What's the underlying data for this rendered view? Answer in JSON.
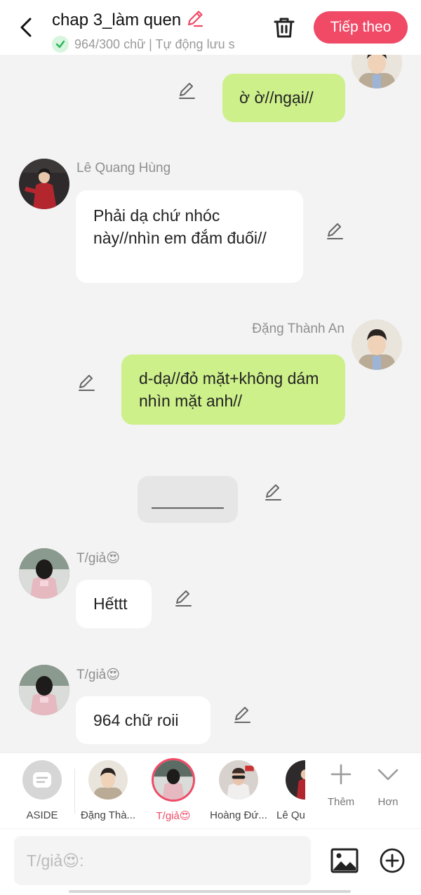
{
  "header": {
    "title": "chap 3_làm quen",
    "subtitle": "964/300 chữ | Tự động lưu s",
    "next_label": "Tiếp theo"
  },
  "messages": [
    {
      "speaker": "",
      "text": "ờ ờ//ngại//",
      "side": "right",
      "style": "green"
    },
    {
      "speaker": "Lê Quang Hùng",
      "text": "Phải dạ chứ nhóc này//nhìn em đắm đuối//",
      "side": "left",
      "style": "white"
    },
    {
      "speaker": "Đặng Thành An",
      "text": "d-dạ//đỏ mặt+không dám nhìn mặt anh//",
      "side": "right",
      "style": "green"
    },
    {
      "speaker": "",
      "text": "________",
      "side": "center",
      "style": "aside"
    },
    {
      "speaker": "T/giả😍",
      "text": "Hếttt",
      "side": "left",
      "style": "white"
    },
    {
      "speaker": "T/giả😍",
      "text": "964 chữ roii",
      "side": "left",
      "style": "white"
    }
  ],
  "characters": [
    {
      "label": "ASIDE"
    },
    {
      "label": "Đặng Thà..."
    },
    {
      "label": "T/giả😍",
      "active": true
    },
    {
      "label": "Hoàng Đứ..."
    },
    {
      "label": "Lê Qu"
    }
  ],
  "tools": {
    "add_label": "Thêm",
    "more_label": "Hơn"
  },
  "input": {
    "placeholder": "T/giả😍:"
  },
  "colors": {
    "accent": "#f04a67",
    "bubble_green": "#cdf08a",
    "bubble_white": "#ffffff",
    "background": "#f3f3f3"
  }
}
